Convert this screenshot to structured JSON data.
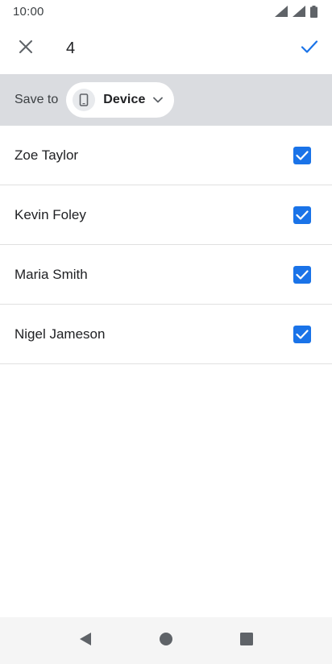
{
  "status_bar": {
    "time": "10:00",
    "icons": [
      "signal-icon",
      "signal-icon",
      "battery-icon"
    ]
  },
  "top_bar": {
    "close_icon": "close-icon",
    "selected_count": "4",
    "confirm_icon": "check-icon",
    "accent_color": "#1a73e8"
  },
  "save_bar": {
    "label": "Save to",
    "account_chip": {
      "icon": "phone-icon",
      "label": "Device",
      "dropdown_icon": "chevron-down-icon"
    },
    "background_color": "#dadce0"
  },
  "contacts": [
    {
      "name": "Zoe Taylor",
      "checked": true
    },
    {
      "name": "Kevin Foley",
      "checked": true
    },
    {
      "name": "Maria Smith",
      "checked": true
    },
    {
      "name": "Nigel Jameson",
      "checked": true
    }
  ],
  "nav_bar": {
    "buttons": [
      "back-icon",
      "home-icon",
      "recents-icon"
    ]
  }
}
